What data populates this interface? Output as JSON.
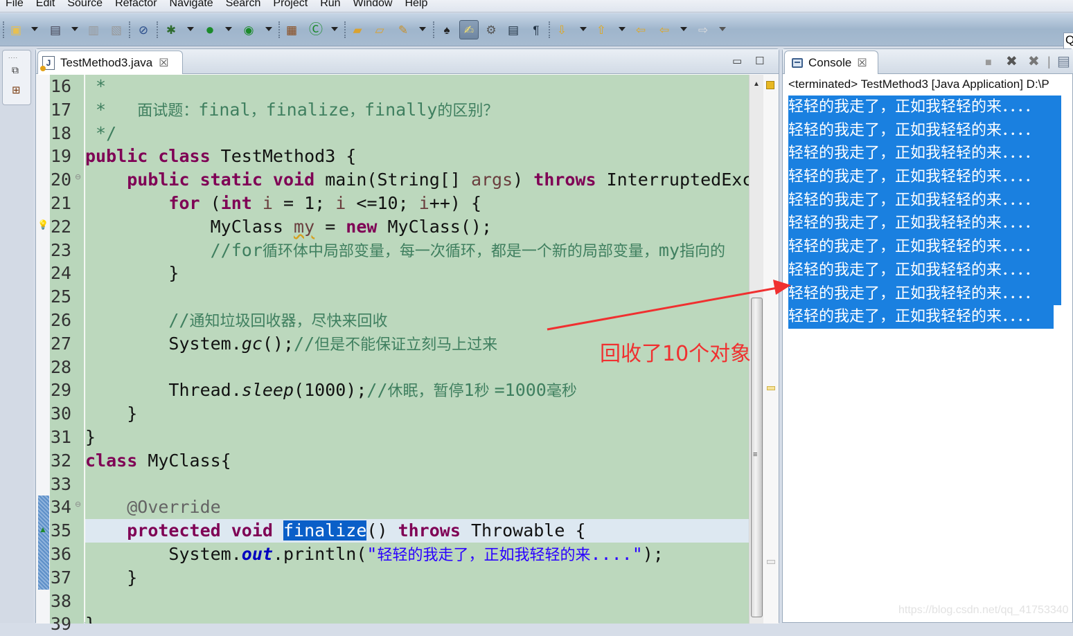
{
  "menubar": {
    "items": [
      "File",
      "Edit",
      "Source",
      "Refactor",
      "Navigate",
      "Search",
      "Project",
      "Run",
      "Window",
      "Help"
    ]
  },
  "toolbar": {
    "icons": [
      "new-icon",
      "new-type-icon",
      "save-icon",
      "save-all-icon",
      "skip-breakpoints-icon",
      "debug-icon",
      "run-icon",
      "external-tools-icon",
      "new-package-icon",
      "new-class-icon",
      "open-type-icon",
      "open-resource-icon",
      "search-icon",
      "toggle-mark-occurrences-icon",
      "highlight-icon",
      "breadcrumb-icon",
      "block-selection-icon",
      "show-whitespace-icon",
      "next-annotation-icon",
      "prev-annotation-icon",
      "last-edit-icon",
      "back-icon",
      "forward-icon"
    ],
    "search_glyph": "Q"
  },
  "editor": {
    "tab": {
      "label": "TestMethod3.java",
      "close": "☒"
    },
    "minimize": "▭",
    "maximize": "☐",
    "lines": [
      {
        "n": "16",
        "parts": [
          {
            "t": " *",
            "c": "cm"
          }
        ]
      },
      {
        "n": "17",
        "parts": [
          {
            "t": " *   ",
            "c": "cm"
          },
          {
            "t": "面试题：",
            "c": "cmj"
          },
          {
            "t": "final",
            "c": "cm"
          },
          {
            "t": "，",
            "c": "cmj"
          },
          {
            "t": "finalize",
            "c": "cm"
          },
          {
            "t": "，",
            "c": "cmj"
          },
          {
            "t": "finally",
            "c": "cm"
          },
          {
            "t": "的区别？",
            "c": "cmj"
          }
        ]
      },
      {
        "n": "18",
        "parts": [
          {
            "t": " */",
            "c": "cm"
          }
        ]
      },
      {
        "n": "19",
        "parts": [
          {
            "t": "public class",
            "c": "kw"
          },
          {
            "t": " TestMethod3 {",
            "c": ""
          }
        ]
      },
      {
        "n": "20",
        "fold": true,
        "parts": [
          {
            "t": "    ",
            "c": ""
          },
          {
            "t": "public static void",
            "c": "kw"
          },
          {
            "t": " main(String[] ",
            "c": ""
          },
          {
            "t": "args",
            "c": "var"
          },
          {
            "t": ") ",
            "c": ""
          },
          {
            "t": "throws",
            "c": "kw"
          },
          {
            "t": " InterruptedException {",
            "c": ""
          }
        ]
      },
      {
        "n": "21",
        "parts": [
          {
            "t": "        ",
            "c": ""
          },
          {
            "t": "for",
            "c": "kw"
          },
          {
            "t": " (",
            "c": ""
          },
          {
            "t": "int",
            "c": "kw"
          },
          {
            "t": " ",
            "c": ""
          },
          {
            "t": "i",
            "c": "var"
          },
          {
            "t": " = 1; ",
            "c": ""
          },
          {
            "t": "i",
            "c": "var"
          },
          {
            "t": " <=10; ",
            "c": ""
          },
          {
            "t": "i",
            "c": "var"
          },
          {
            "t": "++) {",
            "c": ""
          }
        ]
      },
      {
        "n": "22",
        "warn": true,
        "parts": [
          {
            "t": "            MyClass ",
            "c": ""
          },
          {
            "t": "my",
            "c": "var warn-underline"
          },
          {
            "t": " = ",
            "c": ""
          },
          {
            "t": "new",
            "c": "kw"
          },
          {
            "t": " MyClass();",
            "c": ""
          }
        ]
      },
      {
        "n": "23",
        "parts": [
          {
            "t": "            //for",
            "c": "cm"
          },
          {
            "t": "循环体中局部变量，每一次循环，都是一个新的局部变量，",
            "c": "cmj"
          },
          {
            "t": "my",
            "c": "cm"
          },
          {
            "t": "指向的",
            "c": "cmj"
          }
        ]
      },
      {
        "n": "24",
        "parts": [
          {
            "t": "        }",
            "c": ""
          }
        ]
      },
      {
        "n": "25",
        "parts": []
      },
      {
        "n": "26",
        "parts": [
          {
            "t": "        //",
            "c": "cm"
          },
          {
            "t": "通知垃圾回收器，尽快来回收",
            "c": "cmj"
          }
        ]
      },
      {
        "n": "27",
        "parts": [
          {
            "t": "        System.",
            "c": ""
          },
          {
            "t": "gc",
            "c": "it"
          },
          {
            "t": "();",
            "c": ""
          },
          {
            "t": "//",
            "c": "cm"
          },
          {
            "t": "但是不能保证立刻马上过来",
            "c": "cmj"
          }
        ]
      },
      {
        "n": "28",
        "parts": []
      },
      {
        "n": "29",
        "parts": [
          {
            "t": "        Thread.",
            "c": ""
          },
          {
            "t": "sleep",
            "c": "it"
          },
          {
            "t": "(1000);",
            "c": ""
          },
          {
            "t": "//",
            "c": "cm"
          },
          {
            "t": "休眠，暂停",
            "c": "cmj"
          },
          {
            "t": "1",
            "c": "cm"
          },
          {
            "t": "秒 ",
            "c": "cmj"
          },
          {
            "t": "=1000",
            "c": "cm"
          },
          {
            "t": "毫秒",
            "c": "cmj"
          }
        ]
      },
      {
        "n": "30",
        "parts": [
          {
            "t": "    }",
            "c": ""
          }
        ]
      },
      {
        "n": "31",
        "parts": [
          {
            "t": "}",
            "c": ""
          }
        ]
      },
      {
        "n": "32",
        "parts": [
          {
            "t": "class",
            "c": "kw"
          },
          {
            "t": " MyClass{",
            "c": ""
          }
        ]
      },
      {
        "n": "33",
        "parts": []
      },
      {
        "n": "34",
        "fold": true,
        "parts": [
          {
            "t": "    ",
            "c": ""
          },
          {
            "t": "@Override",
            "c": "ann"
          }
        ]
      },
      {
        "n": "35",
        "current": true,
        "override": true,
        "parts": [
          {
            "t": "    ",
            "c": ""
          },
          {
            "t": "protected void",
            "c": "kw"
          },
          {
            "t": " ",
            "c": ""
          },
          {
            "t": "finalize",
            "c": "sel"
          },
          {
            "t": "() ",
            "c": ""
          },
          {
            "t": "throws",
            "c": "kw"
          },
          {
            "t": " Throwable {",
            "c": ""
          }
        ]
      },
      {
        "n": "36",
        "parts": [
          {
            "t": "        System.",
            "c": ""
          },
          {
            "t": "out",
            "c": "fld"
          },
          {
            "t": ".println(",
            "c": ""
          },
          {
            "t": "\"",
            "c": "str"
          },
          {
            "t": "轻轻的我走了，正如我轻轻的来",
            "c": "strj"
          },
          {
            "t": "....\"",
            "c": "str"
          },
          {
            "t": ");",
            "c": ""
          }
        ]
      },
      {
        "n": "37",
        "parts": [
          {
            "t": "    }",
            "c": ""
          }
        ]
      },
      {
        "n": "38",
        "parts": []
      },
      {
        "n": "39",
        "parts": [
          {
            "t": "}",
            "c": ""
          }
        ]
      }
    ]
  },
  "console": {
    "tab": {
      "label": "Console",
      "close": "☒"
    },
    "status": "<terminated> TestMethod3 [Java Application] D:\\P",
    "output": [
      "轻轻的我走了，正如我轻轻的来．．．．",
      "轻轻的我走了，正如我轻轻的来．．．．",
      "轻轻的我走了，正如我轻轻的来．．．．",
      "轻轻的我走了，正如我轻轻的来．．．．",
      "轻轻的我走了，正如我轻轻的来．．．．",
      "轻轻的我走了，正如我轻轻的来．．．．",
      "轻轻的我走了，正如我轻轻的来．．．．",
      "轻轻的我走了，正如我轻轻的来．．．．",
      "轻轻的我走了，正如我轻轻的来．．．．",
      "轻轻的我走了，正如我轻轻的来．．．．"
    ]
  },
  "annotation": {
    "text": "回收了10个对象",
    "color": "#f03030"
  },
  "watermark": "https://blog.csdn.net/qq_41753340",
  "colors": {
    "editor_bg": "#bcd8bd",
    "keyword": "#7f0055",
    "comment": "#3f7f5f",
    "string": "#2a00ff",
    "selection": "#1a80e0"
  }
}
